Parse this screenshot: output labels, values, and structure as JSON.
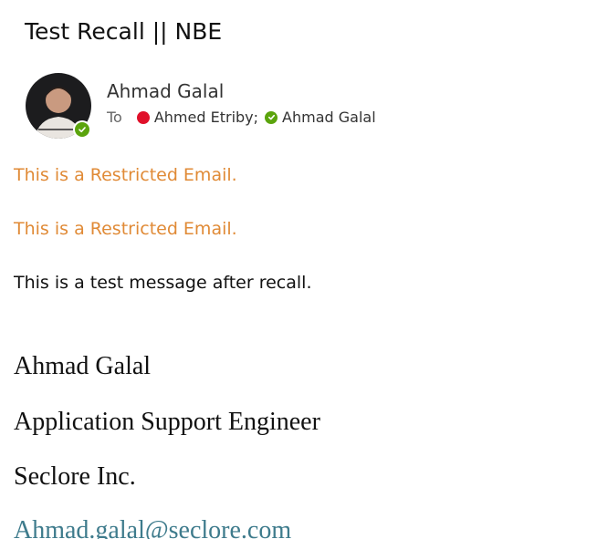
{
  "email": {
    "subject": "Test Recall || NBE",
    "sender": {
      "name": "Ahmad Galal",
      "presence": "available",
      "presence_color": "#5ba40d"
    },
    "to_label": "To",
    "recipients": [
      {
        "name": "Ahmed Etriby;",
        "status_color": "#e0102a",
        "status": "busy"
      },
      {
        "name": "Ahmad Galal",
        "status_color": "#5ba40d",
        "status": "available"
      }
    ],
    "body": {
      "restricted_line_1": "This is a Restricted Email.",
      "restricted_line_2": "This is a Restricted Email.",
      "message": "This is a test message after recall.",
      "restricted_color": "#e08a36"
    },
    "signature": {
      "name": "Ahmad Galal",
      "title": "Application Support Engineer",
      "company": "Seclore Inc.",
      "email": "Ahmad.galal@seclore.com",
      "email_color": "#3e7b8c"
    }
  }
}
